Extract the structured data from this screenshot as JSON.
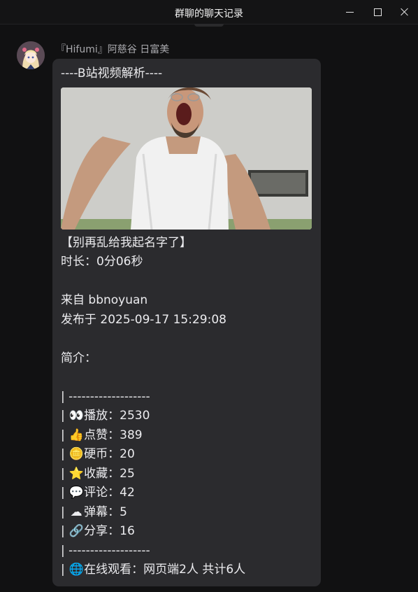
{
  "window": {
    "title": "群聊的聊天记录",
    "minimize_icon": "minimize-icon",
    "maximize_icon": "maximize-icon",
    "close_icon": "close-icon"
  },
  "message": {
    "sender": "『Hifumi』阿慈谷 日富美",
    "header": "----B站视频解析----",
    "video_title": "【别再乱给我起名字了】",
    "duration": "时长：0分06秒",
    "author": "来自 bbnoyuan",
    "published": "发布于 2025-09-17 15:29:08",
    "intro": "简介：",
    "divider": "| -------------------",
    "stats": [
      {
        "prefix": "| ",
        "emoji": "👀",
        "label": "播放：2530"
      },
      {
        "prefix": "| ",
        "emoji": "👍",
        "label": "点赞：389"
      },
      {
        "prefix": "| ",
        "emoji": "🪙",
        "label": "硬币：20"
      },
      {
        "prefix": "| ",
        "emoji": "⭐",
        "label": "收藏：25"
      },
      {
        "prefix": "| ",
        "emoji": "💬",
        "label": "评论：42"
      },
      {
        "prefix": "| ",
        "emoji": "☁",
        "label": "弹幕：5"
      },
      {
        "prefix": "| ",
        "emoji": "🔗",
        "label": "分享：16"
      }
    ],
    "online": {
      "prefix": "| ",
      "emoji": "🌐",
      "label": "在线观看：网页端2人 共计6人"
    }
  }
}
